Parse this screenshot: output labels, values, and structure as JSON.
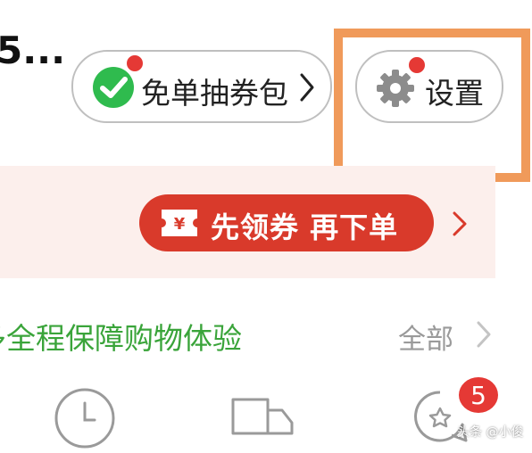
{
  "header": {
    "username_fragment": "5...",
    "coupon_pill": {
      "label": "免单抽券包",
      "icon": "wechat-check-icon"
    },
    "settings_pill": {
      "label": "设置",
      "icon": "gear-icon"
    }
  },
  "banner": {
    "cta_label": "先领券 再下单",
    "cta_icon": "yen-coupon-icon"
  },
  "guarantee": {
    "text": "多全程保障购物体验",
    "view_all": "全部"
  },
  "bottom_icons": {
    "items": [
      {
        "icon": "clock-icon"
      },
      {
        "icon": "truck-icon"
      },
      {
        "icon": "star-chat-icon",
        "badge": "5"
      }
    ]
  },
  "watermark": "头条 @小俊",
  "colors": {
    "accent_red": "#d93a2b",
    "highlight_orange": "#f09a5a",
    "guarantee_green": "#3aa43a",
    "banner_bg": "#fcefec",
    "wechat_green": "#2fbb4e"
  }
}
